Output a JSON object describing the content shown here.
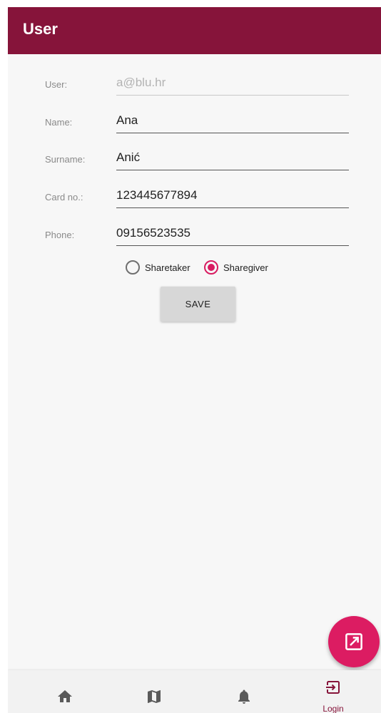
{
  "app_bar": {
    "title": "User"
  },
  "form": {
    "fields": [
      {
        "label": "User:",
        "value": "a@blu.hr",
        "disabled": true
      },
      {
        "label": "Name:",
        "value": "Ana"
      },
      {
        "label": "Surname:",
        "value": "Anić"
      },
      {
        "label": "Card no.:",
        "value": "123445677894"
      },
      {
        "label": "Phone:",
        "value": "09156523535"
      }
    ],
    "role_options": [
      {
        "label": "Sharetaker",
        "selected": false
      },
      {
        "label": "Sharegiver",
        "selected": true
      }
    ],
    "save_label": "SAVE"
  },
  "fab": {
    "icon": "open-in-new-icon",
    "color": "#dc1c62"
  },
  "bottom_nav": {
    "items": [
      {
        "icon": "home-icon",
        "label": ""
      },
      {
        "icon": "map-icon",
        "label": ""
      },
      {
        "icon": "bell-icon",
        "label": ""
      },
      {
        "icon": "login-icon",
        "label": "Login",
        "active": true
      }
    ]
  },
  "colors": {
    "primary": "#86143a",
    "accent": "#d81b60",
    "background": "#f7f7f7"
  }
}
